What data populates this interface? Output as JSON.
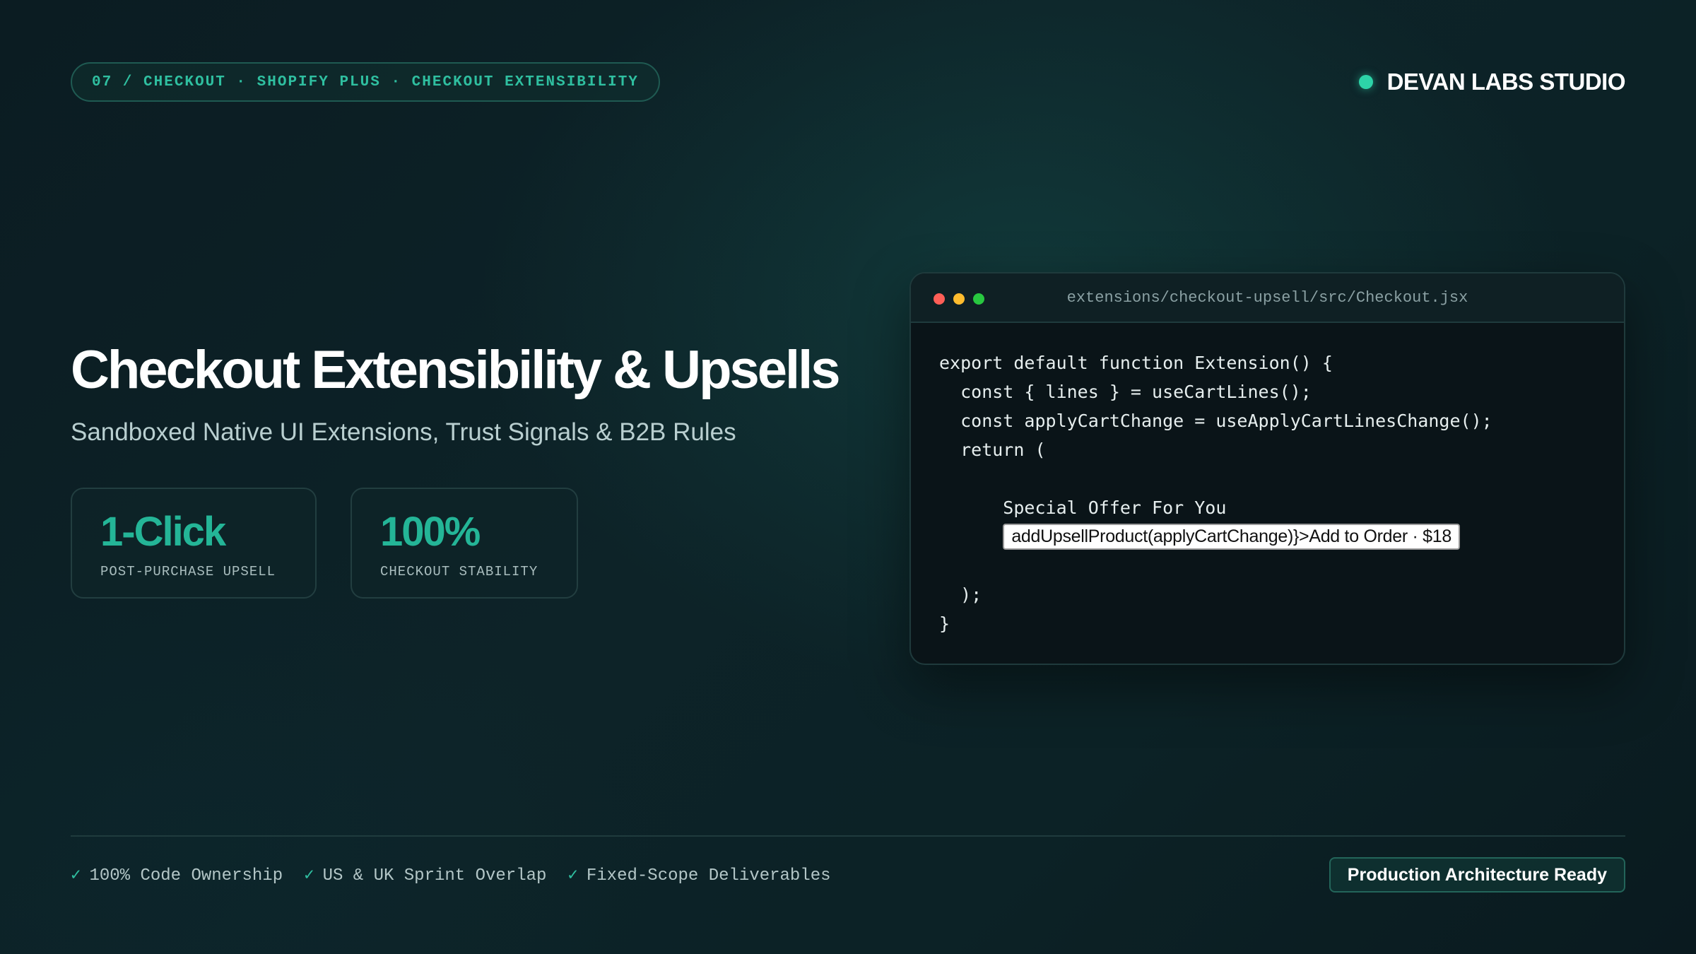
{
  "header": {
    "breadcrumb": "07 / CHECKOUT · SHOPIFY PLUS · CHECKOUT EXTENSIBILITY",
    "brand": "DEVAN LABS STUDIO"
  },
  "hero": {
    "title": "Checkout Extensibility & Upsells",
    "subtitle": "Sandboxed Native UI Extensions, Trust Signals & B2B Rules"
  },
  "stats": [
    {
      "value": "1-Click",
      "label": "POST-PURCHASE UPSELL"
    },
    {
      "value": "100%",
      "label": "CHECKOUT STABILITY"
    }
  ],
  "code": {
    "filename": "extensions/checkout-upsell/src/Checkout.jsx",
    "lines": [
      "export default function Extension() {",
      "  const { lines } = useCartLines();",
      "  const applyCartChange = useApplyCartLinesChange();",
      "  return (",
      "",
      "      Special Offer For You",
      "",
      "",
      "  );",
      "}"
    ],
    "button_text": "addUpsellProduct(applyCartChange)}>Add to Order · $18"
  },
  "footer": {
    "features": [
      "100% Code Ownership",
      "US & UK Sprint Overlap",
      "Fixed-Scope Deliverables"
    ],
    "check_glyph": "✓",
    "status_badge": "Production Architecture Ready"
  },
  "colors": {
    "accent": "#2fbfa0",
    "brand_dot": "#2dd4a8",
    "background": "#0d2328"
  },
  "icons": {
    "brand_dot": "status-dot-icon",
    "window_controls": [
      "close-dot-icon",
      "minimize-dot-icon",
      "maximize-dot-icon"
    ],
    "feature_check": "check-icon"
  }
}
